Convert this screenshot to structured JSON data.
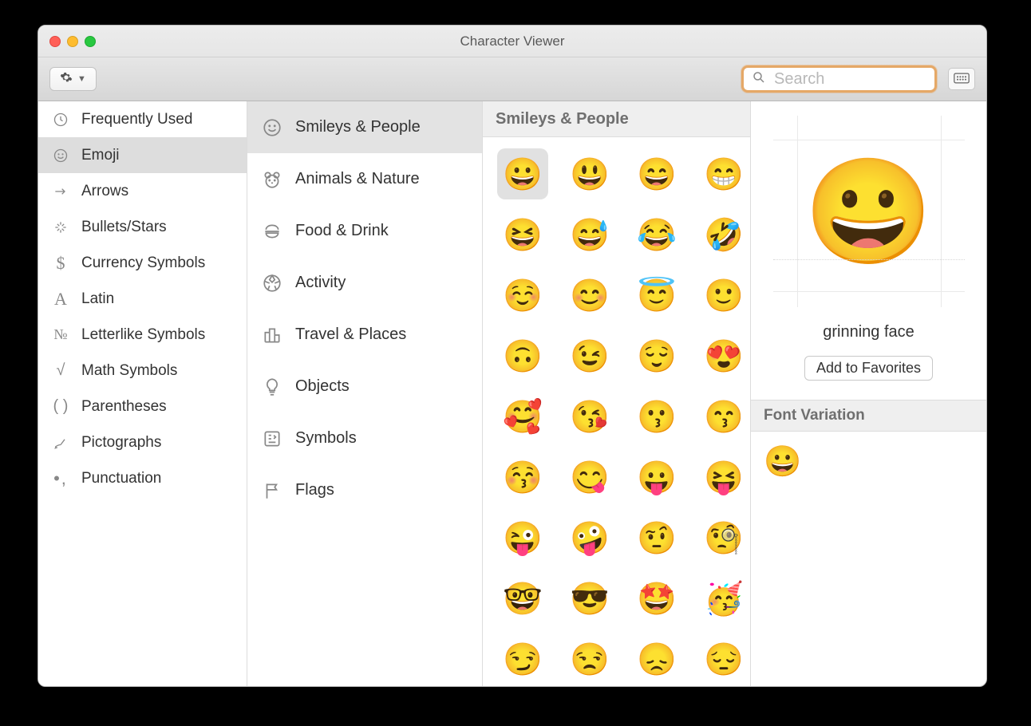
{
  "window": {
    "title": "Character Viewer"
  },
  "search": {
    "placeholder": "Search"
  },
  "sidebar": {
    "items": [
      {
        "icon": "clock",
        "label": "Frequently Used",
        "selected": false
      },
      {
        "icon": "smile",
        "label": "Emoji",
        "selected": true
      },
      {
        "icon": "arrow",
        "label": "Arrows",
        "selected": false
      },
      {
        "icon": "sparkle",
        "label": "Bullets/Stars",
        "selected": false
      },
      {
        "icon": "dollar",
        "label": "Currency Symbols",
        "selected": false
      },
      {
        "icon": "latin",
        "label": "Latin",
        "selected": false
      },
      {
        "icon": "numero",
        "label": "Letterlike Symbols",
        "selected": false
      },
      {
        "icon": "root",
        "label": "Math Symbols",
        "selected": false
      },
      {
        "icon": "parens",
        "label": "Parentheses",
        "selected": false
      },
      {
        "icon": "sign",
        "label": "Pictographs",
        "selected": false
      },
      {
        "icon": "dots",
        "label": "Punctuation",
        "selected": false
      }
    ]
  },
  "categories": {
    "items": [
      {
        "icon": "smile",
        "label": "Smileys & People",
        "selected": true
      },
      {
        "icon": "bear",
        "label": "Animals & Nature",
        "selected": false
      },
      {
        "icon": "burger",
        "label": "Food & Drink",
        "selected": false
      },
      {
        "icon": "ball",
        "label": "Activity",
        "selected": false
      },
      {
        "icon": "city",
        "label": "Travel & Places",
        "selected": false
      },
      {
        "icon": "bulb",
        "label": "Objects",
        "selected": false
      },
      {
        "icon": "symbols",
        "label": "Symbols",
        "selected": false
      },
      {
        "icon": "flag",
        "label": "Flags",
        "selected": false
      }
    ]
  },
  "grid": {
    "heading": "Smileys & People",
    "cells": [
      {
        "char": "😀",
        "name": "grinning-face",
        "selected": true
      },
      {
        "char": "😃",
        "name": "grinning-face-big-eyes"
      },
      {
        "char": "😄",
        "name": "grinning-face-smiling-eyes"
      },
      {
        "char": "😁",
        "name": "beaming-face"
      },
      {
        "char": "😆",
        "name": "squinting-face"
      },
      {
        "char": "😅",
        "name": "sweat-smile"
      },
      {
        "char": "😂",
        "name": "tears-of-joy"
      },
      {
        "char": "🤣",
        "name": "rofl"
      },
      {
        "char": "☺️",
        "name": "relaxed"
      },
      {
        "char": "😊",
        "name": "smiling-face-smiling-eyes"
      },
      {
        "char": "😇",
        "name": "halo"
      },
      {
        "char": "🙂",
        "name": "slightly-smiling"
      },
      {
        "char": "🙃",
        "name": "upside-down"
      },
      {
        "char": "😉",
        "name": "winking"
      },
      {
        "char": "😌",
        "name": "relieved"
      },
      {
        "char": "😍",
        "name": "heart-eyes"
      },
      {
        "char": "🥰",
        "name": "smiling-hearts"
      },
      {
        "char": "😘",
        "name": "blowing-kiss"
      },
      {
        "char": "😗",
        "name": "kissing"
      },
      {
        "char": "😙",
        "name": "kissing-smiling-eyes"
      },
      {
        "char": "😚",
        "name": "kissing-closed-eyes"
      },
      {
        "char": "😋",
        "name": "yum"
      },
      {
        "char": "😛",
        "name": "tongue"
      },
      {
        "char": "😝",
        "name": "squinting-tongue"
      },
      {
        "char": "😜",
        "name": "winking-tongue"
      },
      {
        "char": "🤪",
        "name": "zany"
      },
      {
        "char": "🤨",
        "name": "raised-eyebrow"
      },
      {
        "char": "🧐",
        "name": "monocle"
      },
      {
        "char": "🤓",
        "name": "nerd"
      },
      {
        "char": "😎",
        "name": "sunglasses"
      },
      {
        "char": "🤩",
        "name": "star-struck"
      },
      {
        "char": "🥳",
        "name": "partying"
      },
      {
        "char": "😏",
        "name": "smirking"
      },
      {
        "char": "😒",
        "name": "unamused"
      },
      {
        "char": "😞",
        "name": "disappointed"
      },
      {
        "char": "😔",
        "name": "pensive"
      }
    ]
  },
  "preview": {
    "char": "😀",
    "name": "grinning face",
    "favorites_label": "Add to Favorites",
    "font_variation_label": "Font Variation",
    "variants": [
      "😀"
    ]
  }
}
